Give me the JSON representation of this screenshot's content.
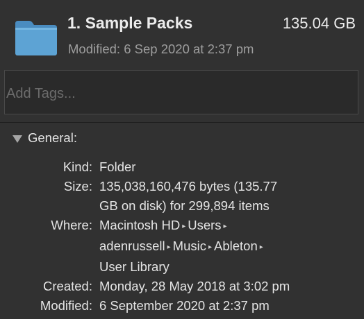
{
  "header": {
    "title": "1. Sample Packs",
    "size": "135.04 GB",
    "modified_label": "Modified:",
    "modified_value": "6 Sep 2020 at 2:37 pm",
    "folder_color": "#5da3d4"
  },
  "tags": {
    "placeholder": "Add Tags..."
  },
  "general": {
    "title": "General:",
    "kind_label": "Kind:",
    "kind_value": "Folder",
    "size_label": "Size:",
    "size_line1": "135,038,160,476 bytes (135.77",
    "size_line2": "GB on disk) for 299,894 items",
    "where_label": "Where:",
    "where_path": [
      "Macintosh HD",
      "Users",
      "adenrussell",
      "Music",
      "Ableton",
      "User Library"
    ],
    "path_separator": "▸",
    "created_label": "Created:",
    "created_value": "Monday, 28 May 2018 at 3:02 pm",
    "modified_label": "Modified:",
    "modified_value": "6 September 2020 at 2:37 pm"
  }
}
